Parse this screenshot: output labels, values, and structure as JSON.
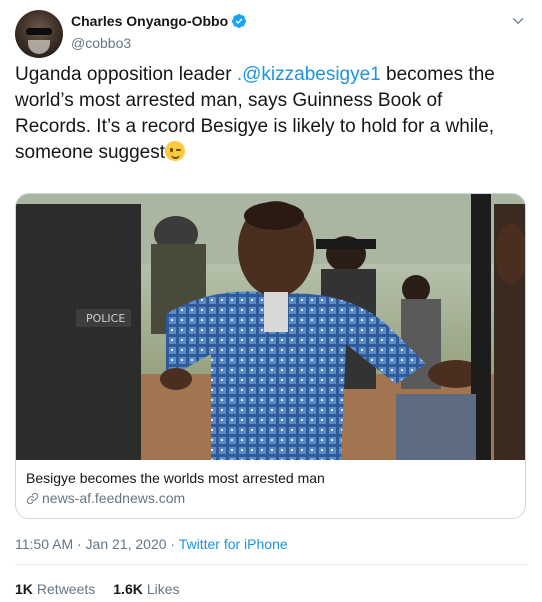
{
  "author": {
    "name": "Charles Onyango-Obbo",
    "handle": "@cobbo3"
  },
  "tweet": {
    "text_before": "Uganda opposition leader ",
    "mention": ".@kizzabesigye1",
    "text_after": " becomes the world’s most arrested man, says Guinness Book of Records. It’s a record Besigye is likely to hold for a while, someone suggest"
  },
  "card": {
    "title": "Besigye becomes the worlds most arrested man",
    "domain": "news-af.feednews.com"
  },
  "meta": {
    "time": "11:50 AM · Jan 21, 2020 · ",
    "source": "Twitter for iPhone"
  },
  "stats": {
    "retweets_count": "1K",
    "retweets_label": "Retweets",
    "likes_count": "1.6K",
    "likes_label": "Likes"
  },
  "colors": {
    "link": "#1b95e0",
    "secondary": "#657786",
    "primary_text": "#14171a",
    "border": "#ccd6dd"
  },
  "icons": [
    "verified-badge-icon",
    "chevron-down-icon",
    "link-icon",
    "winking-face-emoji"
  ]
}
